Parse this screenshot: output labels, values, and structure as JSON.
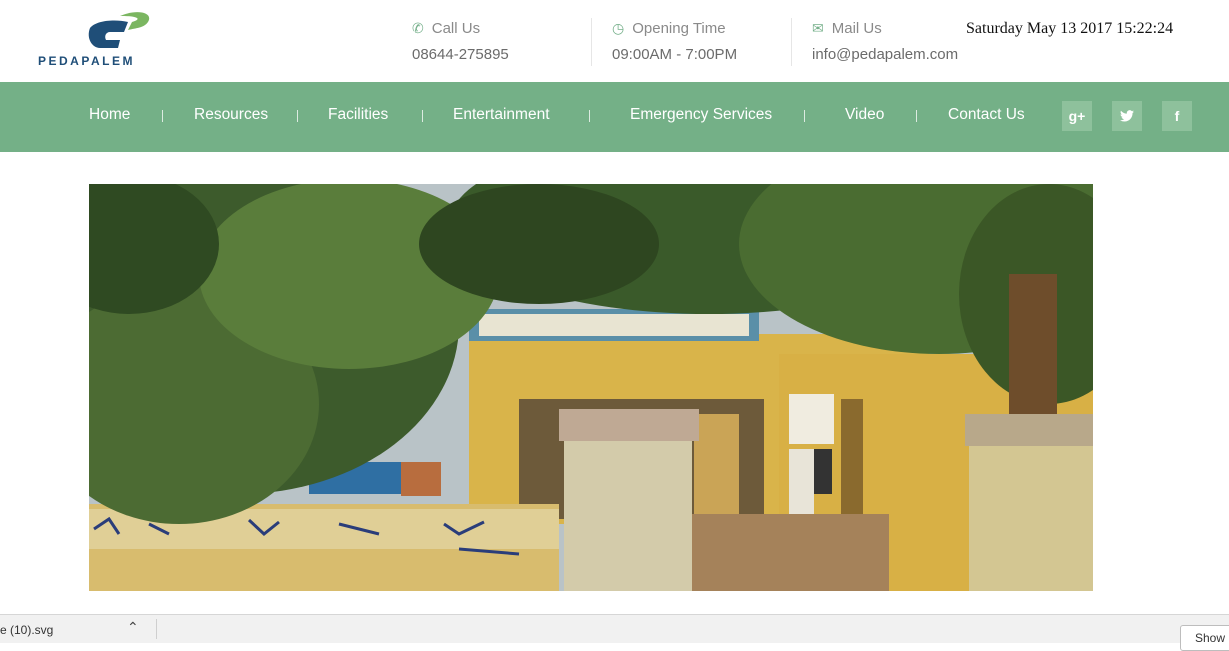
{
  "header": {
    "logo_text": "PEDAPALEM",
    "call": {
      "label": "Call Us",
      "value": "08644-275895",
      "icon": "phone-icon"
    },
    "opening": {
      "label": "Opening Time",
      "value": "09:00AM - 7:00PM",
      "icon": "clock-icon"
    },
    "mail": {
      "label": "Mail Us",
      "value": "info@pedapalem.com",
      "icon": "mail-icon"
    },
    "datetime": "Saturday May 13 2017 15:22:24"
  },
  "nav": {
    "items": [
      {
        "label": "Home"
      },
      {
        "label": "Resources"
      },
      {
        "label": "Facilities"
      },
      {
        "label": "Entertainment"
      },
      {
        "label": "Emergency Services"
      },
      {
        "label": "Video"
      },
      {
        "label": "Contact Us"
      }
    ],
    "social": [
      {
        "icon": "google-plus-icon",
        "glyph": "g+"
      },
      {
        "icon": "twitter-icon",
        "glyph": "🐦"
      },
      {
        "icon": "facebook-icon",
        "glyph": "f"
      }
    ]
  },
  "colors": {
    "nav_bg": "#74b087",
    "accent_icon": "#76b08b",
    "logo_blue": "#1f4e78",
    "logo_green": "#7bb661"
  },
  "download_bar": {
    "file_name": "e (10).svg",
    "show_all": "Show"
  }
}
